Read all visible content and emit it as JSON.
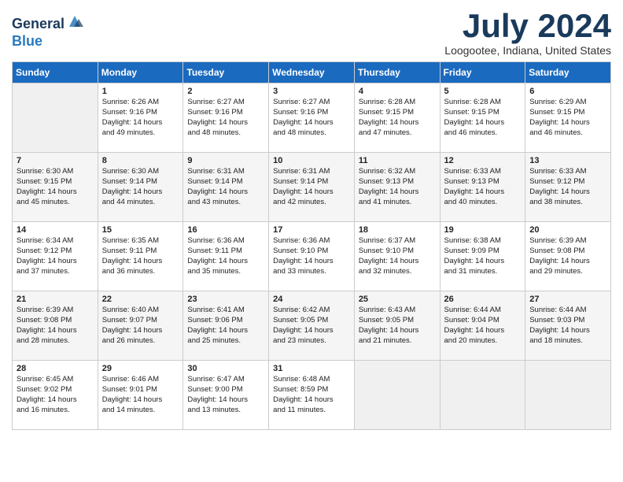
{
  "header": {
    "logo_general": "General",
    "logo_blue": "Blue",
    "month_title": "July 2024",
    "location": "Loogootee, Indiana, United States"
  },
  "days_of_week": [
    "Sunday",
    "Monday",
    "Tuesday",
    "Wednesday",
    "Thursday",
    "Friday",
    "Saturday"
  ],
  "weeks": [
    [
      {
        "day": "",
        "empty": true
      },
      {
        "day": "1",
        "sunrise": "6:26 AM",
        "sunset": "9:16 PM",
        "daylight": "14 hours and 49 minutes."
      },
      {
        "day": "2",
        "sunrise": "6:27 AM",
        "sunset": "9:16 PM",
        "daylight": "14 hours and 48 minutes."
      },
      {
        "day": "3",
        "sunrise": "6:27 AM",
        "sunset": "9:16 PM",
        "daylight": "14 hours and 48 minutes."
      },
      {
        "day": "4",
        "sunrise": "6:28 AM",
        "sunset": "9:15 PM",
        "daylight": "14 hours and 47 minutes."
      },
      {
        "day": "5",
        "sunrise": "6:28 AM",
        "sunset": "9:15 PM",
        "daylight": "14 hours and 46 minutes."
      },
      {
        "day": "6",
        "sunrise": "6:29 AM",
        "sunset": "9:15 PM",
        "daylight": "14 hours and 46 minutes."
      }
    ],
    [
      {
        "day": "7",
        "sunrise": "6:30 AM",
        "sunset": "9:15 PM",
        "daylight": "14 hours and 45 minutes."
      },
      {
        "day": "8",
        "sunrise": "6:30 AM",
        "sunset": "9:14 PM",
        "daylight": "14 hours and 44 minutes."
      },
      {
        "day": "9",
        "sunrise": "6:31 AM",
        "sunset": "9:14 PM",
        "daylight": "14 hours and 43 minutes."
      },
      {
        "day": "10",
        "sunrise": "6:31 AM",
        "sunset": "9:14 PM",
        "daylight": "14 hours and 42 minutes."
      },
      {
        "day": "11",
        "sunrise": "6:32 AM",
        "sunset": "9:13 PM",
        "daylight": "14 hours and 41 minutes."
      },
      {
        "day": "12",
        "sunrise": "6:33 AM",
        "sunset": "9:13 PM",
        "daylight": "14 hours and 40 minutes."
      },
      {
        "day": "13",
        "sunrise": "6:33 AM",
        "sunset": "9:12 PM",
        "daylight": "14 hours and 38 minutes."
      }
    ],
    [
      {
        "day": "14",
        "sunrise": "6:34 AM",
        "sunset": "9:12 PM",
        "daylight": "14 hours and 37 minutes."
      },
      {
        "day": "15",
        "sunrise": "6:35 AM",
        "sunset": "9:11 PM",
        "daylight": "14 hours and 36 minutes."
      },
      {
        "day": "16",
        "sunrise": "6:36 AM",
        "sunset": "9:11 PM",
        "daylight": "14 hours and 35 minutes."
      },
      {
        "day": "17",
        "sunrise": "6:36 AM",
        "sunset": "9:10 PM",
        "daylight": "14 hours and 33 minutes."
      },
      {
        "day": "18",
        "sunrise": "6:37 AM",
        "sunset": "9:10 PM",
        "daylight": "14 hours and 32 minutes."
      },
      {
        "day": "19",
        "sunrise": "6:38 AM",
        "sunset": "9:09 PM",
        "daylight": "14 hours and 31 minutes."
      },
      {
        "day": "20",
        "sunrise": "6:39 AM",
        "sunset": "9:08 PM",
        "daylight": "14 hours and 29 minutes."
      }
    ],
    [
      {
        "day": "21",
        "sunrise": "6:39 AM",
        "sunset": "9:08 PM",
        "daylight": "14 hours and 28 minutes."
      },
      {
        "day": "22",
        "sunrise": "6:40 AM",
        "sunset": "9:07 PM",
        "daylight": "14 hours and 26 minutes."
      },
      {
        "day": "23",
        "sunrise": "6:41 AM",
        "sunset": "9:06 PM",
        "daylight": "14 hours and 25 minutes."
      },
      {
        "day": "24",
        "sunrise": "6:42 AM",
        "sunset": "9:05 PM",
        "daylight": "14 hours and 23 minutes."
      },
      {
        "day": "25",
        "sunrise": "6:43 AM",
        "sunset": "9:05 PM",
        "daylight": "14 hours and 21 minutes."
      },
      {
        "day": "26",
        "sunrise": "6:44 AM",
        "sunset": "9:04 PM",
        "daylight": "14 hours and 20 minutes."
      },
      {
        "day": "27",
        "sunrise": "6:44 AM",
        "sunset": "9:03 PM",
        "daylight": "14 hours and 18 minutes."
      }
    ],
    [
      {
        "day": "28",
        "sunrise": "6:45 AM",
        "sunset": "9:02 PM",
        "daylight": "14 hours and 16 minutes."
      },
      {
        "day": "29",
        "sunrise": "6:46 AM",
        "sunset": "9:01 PM",
        "daylight": "14 hours and 14 minutes."
      },
      {
        "day": "30",
        "sunrise": "6:47 AM",
        "sunset": "9:00 PM",
        "daylight": "14 hours and 13 minutes."
      },
      {
        "day": "31",
        "sunrise": "6:48 AM",
        "sunset": "8:59 PM",
        "daylight": "14 hours and 11 minutes."
      },
      {
        "day": "",
        "empty": true
      },
      {
        "day": "",
        "empty": true
      },
      {
        "day": "",
        "empty": true
      }
    ]
  ]
}
